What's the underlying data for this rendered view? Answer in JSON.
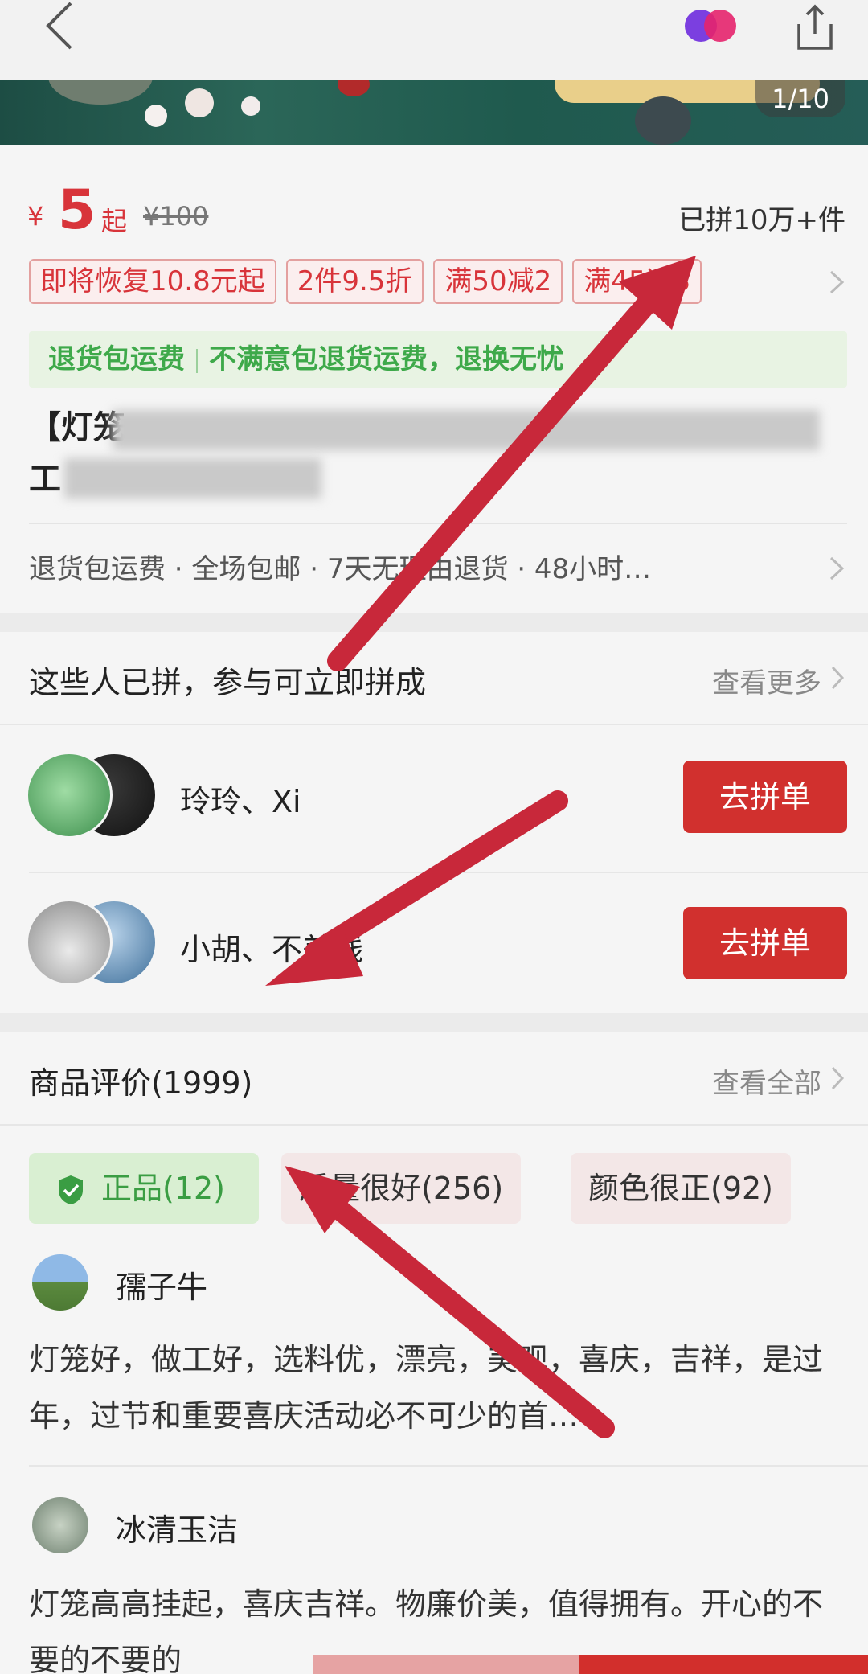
{
  "banner": {
    "counter": "1/10"
  },
  "price": {
    "yen": "¥",
    "amount": "5",
    "qi": "起",
    "original": "¥100",
    "sold": "已拼10万+件"
  },
  "tags": [
    "即将恢复10.8元起",
    "2件9.5折",
    "满50减2",
    "满45返3"
  ],
  "shipping": {
    "part1": "退货包运费",
    "part2": "不满意包退货运费，退换无忧"
  },
  "product": {
    "line1_start": "【灯笼",
    "line2_start": "工"
  },
  "services": "退货包运费 · 全场包邮 · 7天无理由退货 · 48小时…",
  "group": {
    "title": "这些人已拼，参与可立即拼成",
    "more": "查看更多",
    "rows": [
      {
        "names": "玲玲、Xi",
        "button": "去拼单"
      },
      {
        "names": "小胡、不差钱",
        "button": "去拼单"
      }
    ]
  },
  "reviews": {
    "title": "商品评价(1999)",
    "more": "查看全部",
    "chips": [
      "正品(12)",
      "质量很好(256)",
      "颜色很正(92)"
    ],
    "items": [
      {
        "name": "孺子牛",
        "text": "灯笼好，做工好，选料优，漂亮，美观，喜庆，吉祥，是过年，过节和重要喜庆活动必不可少的首…"
      },
      {
        "name": "冰清玉洁",
        "text": "灯笼高高挂起，喜庆吉祥。物廉价美，值得拥有。开心的不要的不要的"
      }
    ]
  },
  "colors": {
    "accent": "#d1302e",
    "green": "#3a9d43",
    "arrow": "#c8283a"
  }
}
